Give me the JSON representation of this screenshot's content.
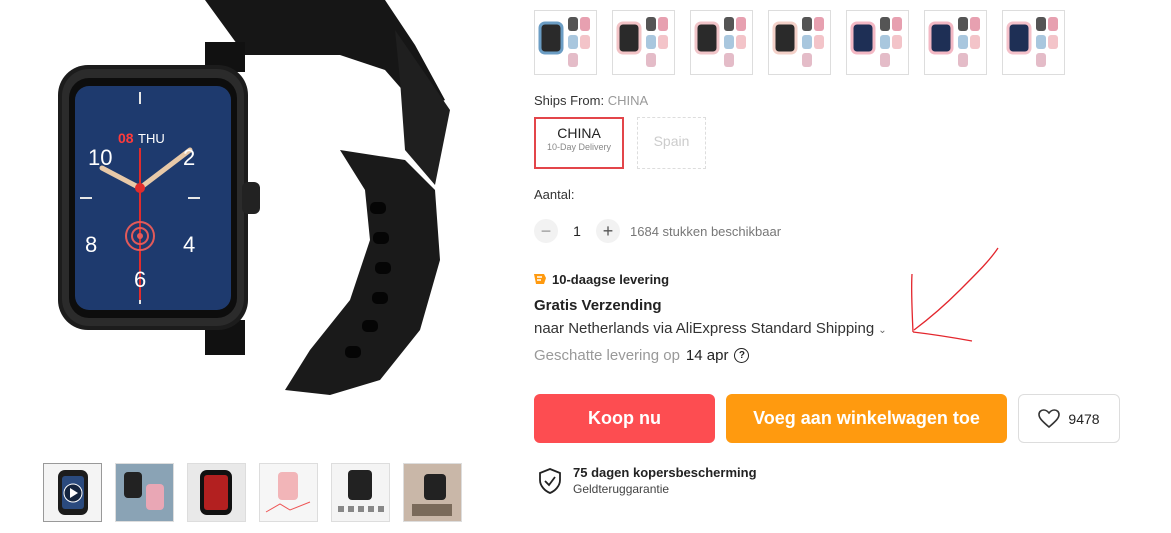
{
  "product": {
    "watch_time": {
      "date_red": "08",
      "day": "THU"
    },
    "dial_numbers": [
      "10",
      "2",
      "8",
      "4",
      "6"
    ]
  },
  "variants": {
    "swatch_colors": [
      "#6b9dc4",
      "#f2c3c6",
      "#f0c4c8",
      "#f3d0c8",
      "#f3b8c4",
      "#f3b8c4",
      "#f4c1ca"
    ]
  },
  "ships_from": {
    "label": "Ships From:",
    "value": "CHINA",
    "options": [
      {
        "name": "CHINA",
        "sub": "10-Day Delivery"
      },
      {
        "name": "Spain",
        "sub": ""
      }
    ]
  },
  "quantity": {
    "label": "Aantal:",
    "minus": "−",
    "plus": "+",
    "value": "1",
    "stock": "1684 stukken beschikbaar"
  },
  "shipping": {
    "badge": "10-daagse levering",
    "title": "Gratis Verzending",
    "method": "naar Netherlands via AliExpress Standard Shipping",
    "estimate_label": "Geschatte levering op",
    "estimate_date": "14 apr",
    "help": "?"
  },
  "actions": {
    "buy": "Koop nu",
    "cart": "Voeg aan winkelwagen toe",
    "wishlist_count": "9478"
  },
  "protection": {
    "title": "75 dagen kopersbescherming",
    "subtitle": "Geldteruggarantie"
  },
  "colors": {
    "buy": "#fd4d51",
    "cart": "#ff9a0f",
    "selected_border": "#e3454a",
    "badge_icon": "#ff9a0f"
  }
}
